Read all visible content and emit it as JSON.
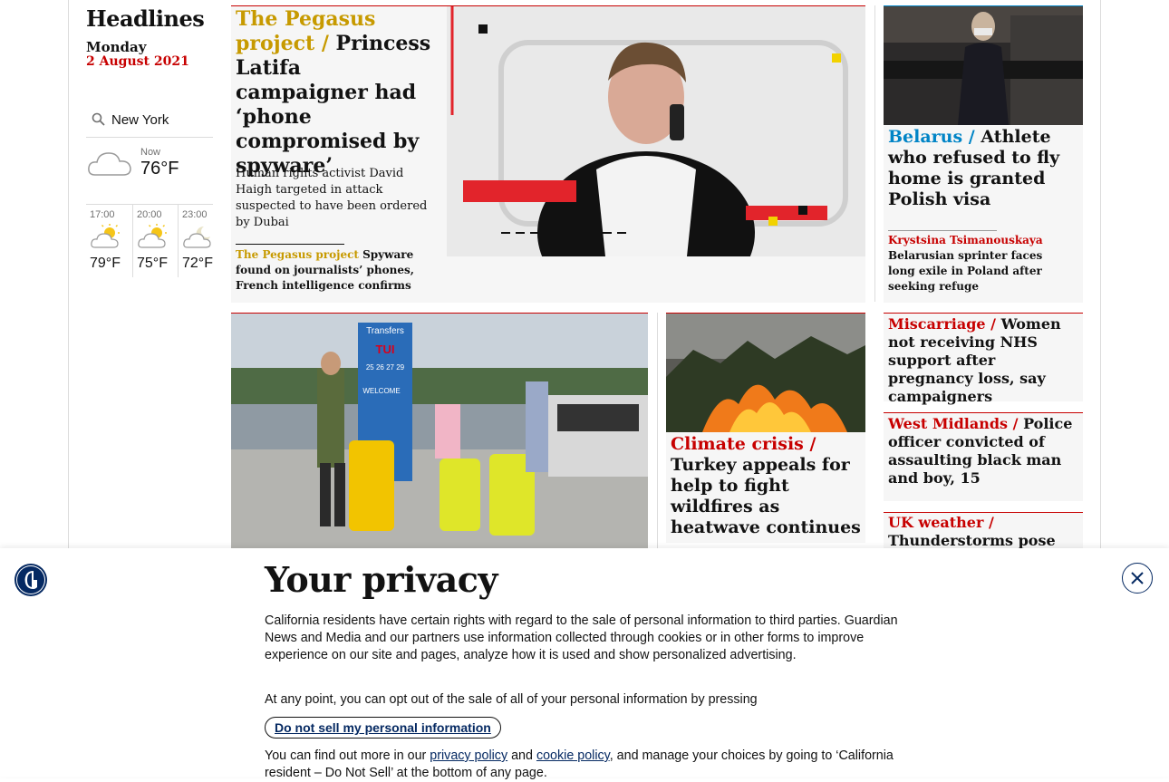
{
  "sidebar": {
    "section_title": "Headlines",
    "day": "Monday",
    "date": "2 August 2021",
    "weather": {
      "location": "New York",
      "now_label": "Now",
      "now_temp": "76°F",
      "forecast": [
        {
          "time": "17:00",
          "temp": "79°F",
          "icon": "sun-cloud-icon"
        },
        {
          "time": "20:00",
          "temp": "75°F",
          "icon": "sun-cloud-icon"
        },
        {
          "time": "23:00",
          "temp": "72°F",
          "icon": "moon-cloud-icon"
        }
      ]
    }
  },
  "main_story": {
    "kicker": "The Pegasus project /",
    "headline": "Princess Latifa campaigner had ‘phone compromised by spyware’",
    "standfirst": "Human rights activist David Haigh targeted in attack suspected to have been ordered by Dubai",
    "sublink_kicker": "The Pegasus project",
    "sublink_text": "Spyware found on journalists’ phones, French intelligence confirms"
  },
  "belarus_story": {
    "kicker": "Belarus /",
    "headline": "Athlete who refused to fly home is granted Polish visa",
    "sublink_kicker": "Krystsina Tsimanouskaya",
    "sublink_text": "Belarusian sprinter faces long exile in Poland after seeking refuge"
  },
  "climate_story": {
    "kicker": "Climate crisis /",
    "headline": "Turkey appeals for help to fight wildfires as heatwave continues"
  },
  "miscarriage_story": {
    "kicker": "Miscarriage /",
    "headline": "Women not receiving NHS support after pregnancy loss, say campaigners"
  },
  "westmidlands_story": {
    "kicker": "West Midlands /",
    "headline": "Police officer convicted of assaulting black man and boy, 15"
  },
  "ukweather_story": {
    "kicker": "UK weather /",
    "headline": "Thunderstorms pose flood"
  },
  "travel_image": {
    "sign_transfers": "Transfers",
    "sign_brand": "TUI",
    "sign_welcome": "WELCOME",
    "sign_numbers": "25 26 27 29"
  },
  "privacy_banner": {
    "title": "Your privacy",
    "body": "California residents have certain rights with regard to the sale of personal information to third parties. Guardian News and Media and our partners use information collected through cookies or in other forms to improve experience on our site and pages, analyze how it is used and show personalized advertising.",
    "optout_text": "At any point, you can opt out of the sale of all of your personal information by pressing",
    "button_label": "Do not sell my personal information",
    "more_prefix": "You can find out more in our",
    "privacy_link": "privacy policy",
    "and_text": "and",
    "cookie_link": "cookie policy",
    "more_suffix": ", and manage your choices by going to ‘California resident – Do Not Sell’ at the bottom of any page."
  },
  "colors": {
    "news_red": "#c70000",
    "pegasus_gold": "#c79a00",
    "world_blue": "#0084c6",
    "brand_navy": "#052962"
  }
}
